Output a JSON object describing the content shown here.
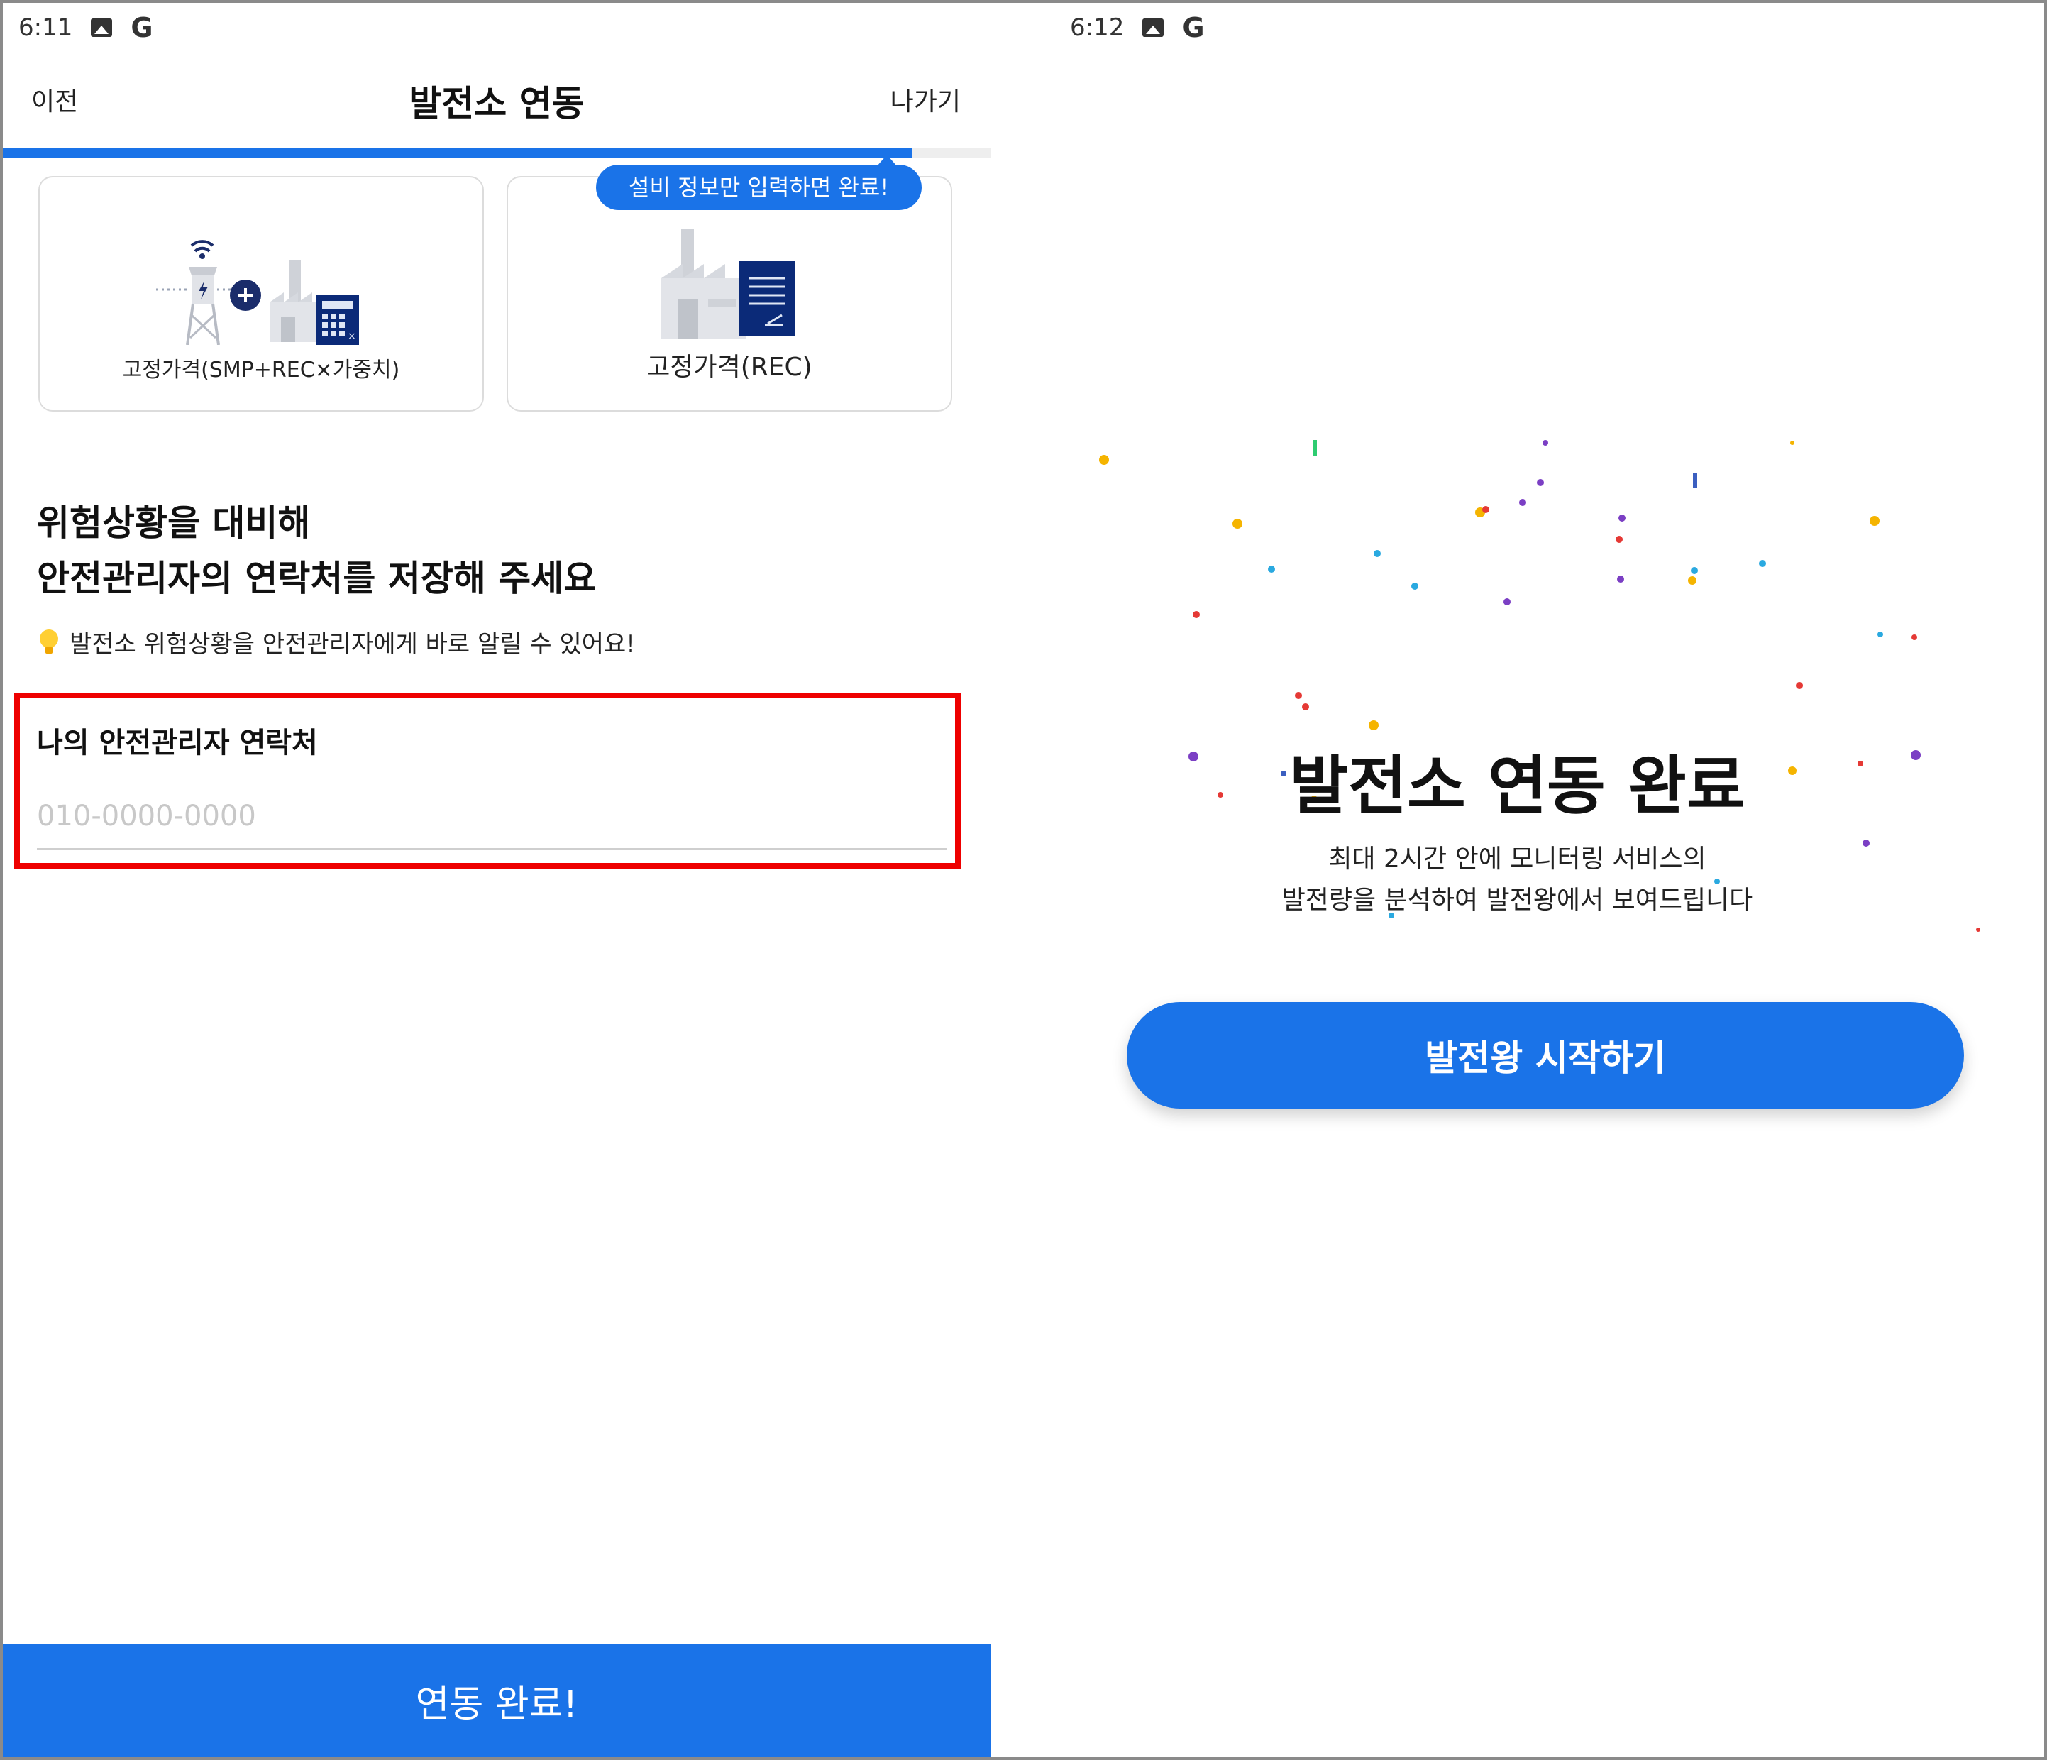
{
  "left": {
    "status": {
      "time": "6:11"
    },
    "header": {
      "prev": "이전",
      "title": "발전소 연동",
      "exit": "나가기"
    },
    "progress": {
      "fraction": 0.92
    },
    "cards": [
      {
        "label": "고정가격(SMP+REC×가중치)"
      },
      {
        "label": "고정가격(REC)"
      }
    ],
    "tooltip": "설비 정보만 입력하면 완료!",
    "headline": {
      "line1": "위험상황을 대비해",
      "line2": "안전관리자의 연락처를 저장해 주세요"
    },
    "hint": "발전소 위험상황을 안전관리자에게 바로 알릴 수 있어요!",
    "field": {
      "label": "나의 안전관리자 연락처",
      "placeholder": "010-0000-0000",
      "value": ""
    },
    "submit": "연동 완료!"
  },
  "right": {
    "status": {
      "time": "6:12"
    },
    "title": "발전소 연동 완료",
    "desc": {
      "line1": "최대 2시간 안에 모니터링 서비스의",
      "line2": "발전량을 분석하여 발전왕에서 보여드립니다"
    },
    "button": "발전왕 시작하기"
  },
  "colors": {
    "accent": "#1a73e8",
    "highlight": "#ee0000"
  }
}
